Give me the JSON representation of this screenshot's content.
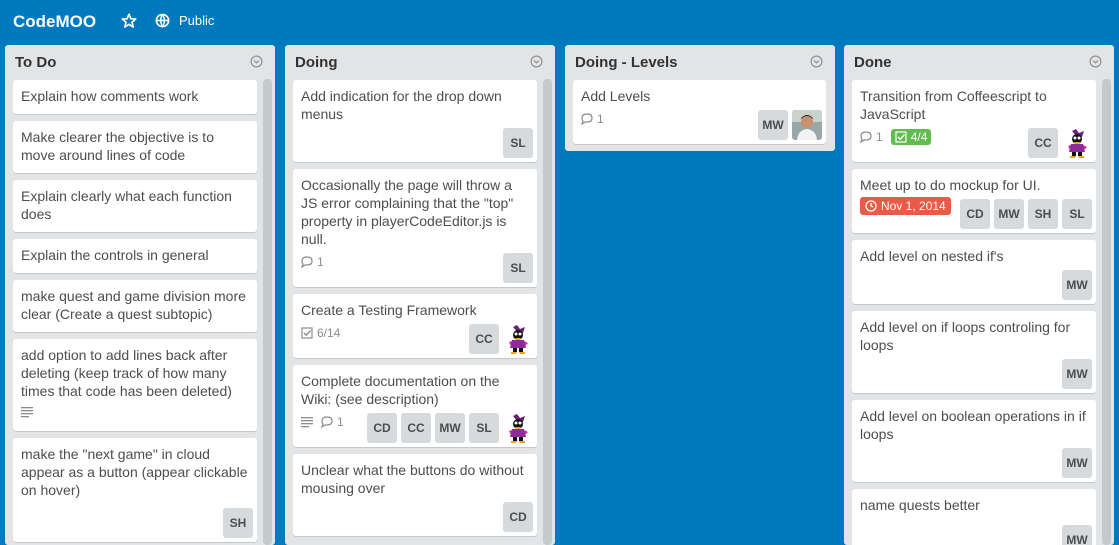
{
  "board": {
    "title": "CodeMOO",
    "visibility": "Public"
  },
  "lists": {
    "todo": {
      "title": "To Do",
      "cards": [
        {
          "title": "Explain how comments work"
        },
        {
          "title": "Make clearer the objective is to move around lines of code"
        },
        {
          "title": "Explain clearly what each function does"
        },
        {
          "title": "Explain the controls in general"
        },
        {
          "title": "make quest and game division more clear (Create a quest subtopic)"
        },
        {
          "title": "add option to add lines back after deleting (keep track of how many times that code has been deleted)"
        },
        {
          "title": "make the \"next game\" in cloud appear as a button (appear clickable on hover)",
          "members": [
            "SH"
          ]
        }
      ]
    },
    "doing": {
      "title": "Doing",
      "cards": [
        {
          "title": "Add indication for the drop down menus",
          "members": [
            "SL"
          ]
        },
        {
          "title": "Occasionally the page will throw a JS error complaining that the \"top\" property in playerCodeEditor.js is null.",
          "comments": "1",
          "members": [
            "SL"
          ]
        },
        {
          "title": "Create a Testing Framework",
          "checklist": "6/14",
          "members": [
            "CC"
          ]
        },
        {
          "title": "Complete documentation on the Wiki: (see description)",
          "comments": "1",
          "members": [
            "CD",
            "CC",
            "MW",
            "SL"
          ]
        },
        {
          "title": "Unclear what the buttons do without mousing over",
          "members": [
            "CD"
          ]
        }
      ]
    },
    "levels": {
      "title": "Doing - Levels",
      "cards": [
        {
          "title": "Add Levels",
          "comments": "1",
          "members": [
            "MW"
          ]
        }
      ]
    },
    "done": {
      "title": "Done",
      "cards": [
        {
          "title": "Transition from Coffeescript to JavaScript",
          "comments": "1",
          "checklist": "4/4",
          "members": [
            "CC"
          ]
        },
        {
          "title": "Meet up to do mockup for UI.",
          "due": "Nov 1, 2014",
          "members": [
            "CD",
            "MW",
            "SH",
            "SL"
          ]
        },
        {
          "title": "Add level on nested if's",
          "members": [
            "MW"
          ]
        },
        {
          "title": "Add level on if loops controling for loops",
          "members": [
            "MW"
          ]
        },
        {
          "title": "Add level on boolean operations in if loops",
          "members": [
            "MW"
          ]
        },
        {
          "title": "name quests better",
          "members": [
            "MW"
          ]
        }
      ]
    }
  },
  "colors": {
    "board_bg": "#0079bf",
    "list_bg": "#e2e4e6",
    "label_green": "#61bd4f",
    "due_red": "#eb5a46"
  },
  "icons": {
    "star": "star-icon",
    "visibility": "globe-icon",
    "list_menu": "chevron-circle-icon",
    "comment": "speech-bubble-icon",
    "checklist": "checkbox-icon",
    "description": "lines-icon",
    "due": "clock-icon"
  }
}
